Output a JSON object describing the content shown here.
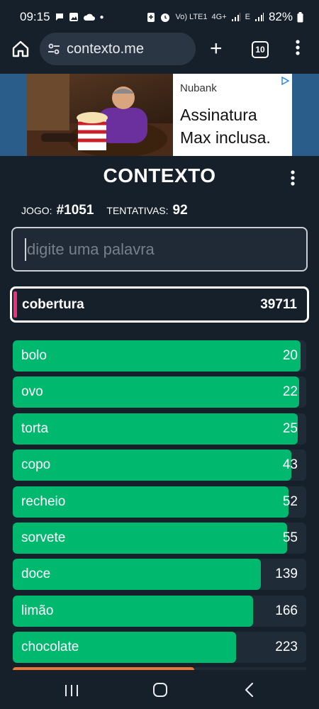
{
  "status_bar": {
    "time": "09:15",
    "network_label": "Vo) LTE1",
    "network_type": "4G+",
    "network_alt": "E",
    "battery": "82%"
  },
  "browser": {
    "url": "contexto.me",
    "tab_count": "10"
  },
  "ad": {
    "brand": "Nubank",
    "headline_line1": "Assinatura",
    "headline_line2": "Max inclusa."
  },
  "game": {
    "title": "CONTEXTO",
    "game_label": "JOGO:",
    "game_number": "#1051",
    "attempts_label": "TENTATIVAS:",
    "attempts": "92",
    "input_placeholder": "digite uma palavra",
    "latest_guess": {
      "word": "cobertura",
      "rank": "39711"
    },
    "guesses": [
      {
        "word": "bolo",
        "rank": "20",
        "fill": 0.98
      },
      {
        "word": "ovo",
        "rank": "22",
        "fill": 0.975
      },
      {
        "word": "torta",
        "rank": "25",
        "fill": 0.97
      },
      {
        "word": "copo",
        "rank": "43",
        "fill": 0.95
      },
      {
        "word": "recheio",
        "rank": "52",
        "fill": 0.94
      },
      {
        "word": "sorvete",
        "rank": "55",
        "fill": 0.935
      },
      {
        "word": "doce",
        "rank": "139",
        "fill": 0.845
      },
      {
        "word": "limão",
        "rank": "166",
        "fill": 0.82
      },
      {
        "word": "chocolate",
        "rank": "223",
        "fill": 0.76
      }
    ]
  },
  "colors": {
    "background": "#15202b",
    "close_match": "#00b96e",
    "medium_match": "#e8793a",
    "latest_marker": "#ee2f7f"
  }
}
